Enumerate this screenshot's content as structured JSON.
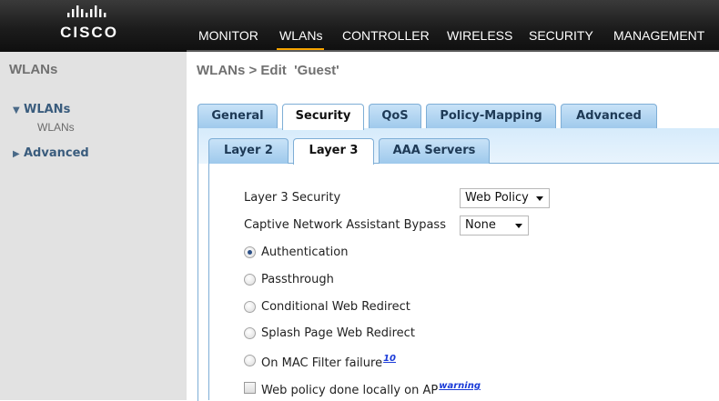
{
  "brand": {
    "logo_text": "CISCO"
  },
  "nav": {
    "items": [
      {
        "label": "MONITOR"
      },
      {
        "label": "WLANs"
      },
      {
        "label": "CONTROLLER"
      },
      {
        "label": "WIRELESS"
      },
      {
        "label": "SECURITY"
      },
      {
        "label": "MANAGEMENT"
      }
    ],
    "active": "WLANs",
    "accent_color": "#f7a400"
  },
  "sidebar": {
    "title": "WLANs",
    "items": [
      {
        "label": "WLANs",
        "expanded": true,
        "children": [
          {
            "label": "WLANs"
          }
        ]
      },
      {
        "label": "Advanced",
        "expanded": false
      }
    ]
  },
  "page": {
    "title": "WLANs > Edit  'Guest'"
  },
  "tabs": {
    "items": [
      {
        "label": "General"
      },
      {
        "label": "Security"
      },
      {
        "label": "QoS"
      },
      {
        "label": "Policy-Mapping"
      },
      {
        "label": "Advanced"
      }
    ],
    "active": "Security"
  },
  "subtabs": {
    "items": [
      {
        "label": "Layer 2"
      },
      {
        "label": "Layer 3"
      },
      {
        "label": "AAA Servers"
      }
    ],
    "active": "Layer 3"
  },
  "form": {
    "layer3_security": {
      "label": "Layer 3 Security",
      "value": "Web Policy"
    },
    "cna_bypass": {
      "label": "Captive Network Assistant Bypass",
      "value": "None"
    },
    "options": [
      {
        "label": "Authentication",
        "checked": true
      },
      {
        "label": "Passthrough",
        "checked": false
      },
      {
        "label": "Conditional Web Redirect",
        "checked": false
      },
      {
        "label": "Splash Page Web Redirect",
        "checked": false
      },
      {
        "label": "On MAC Filter failure",
        "checked": false,
        "footnote": "10"
      }
    ],
    "local_policy": {
      "label": "Web policy done locally on AP",
      "checked": false,
      "link": "warning"
    }
  }
}
